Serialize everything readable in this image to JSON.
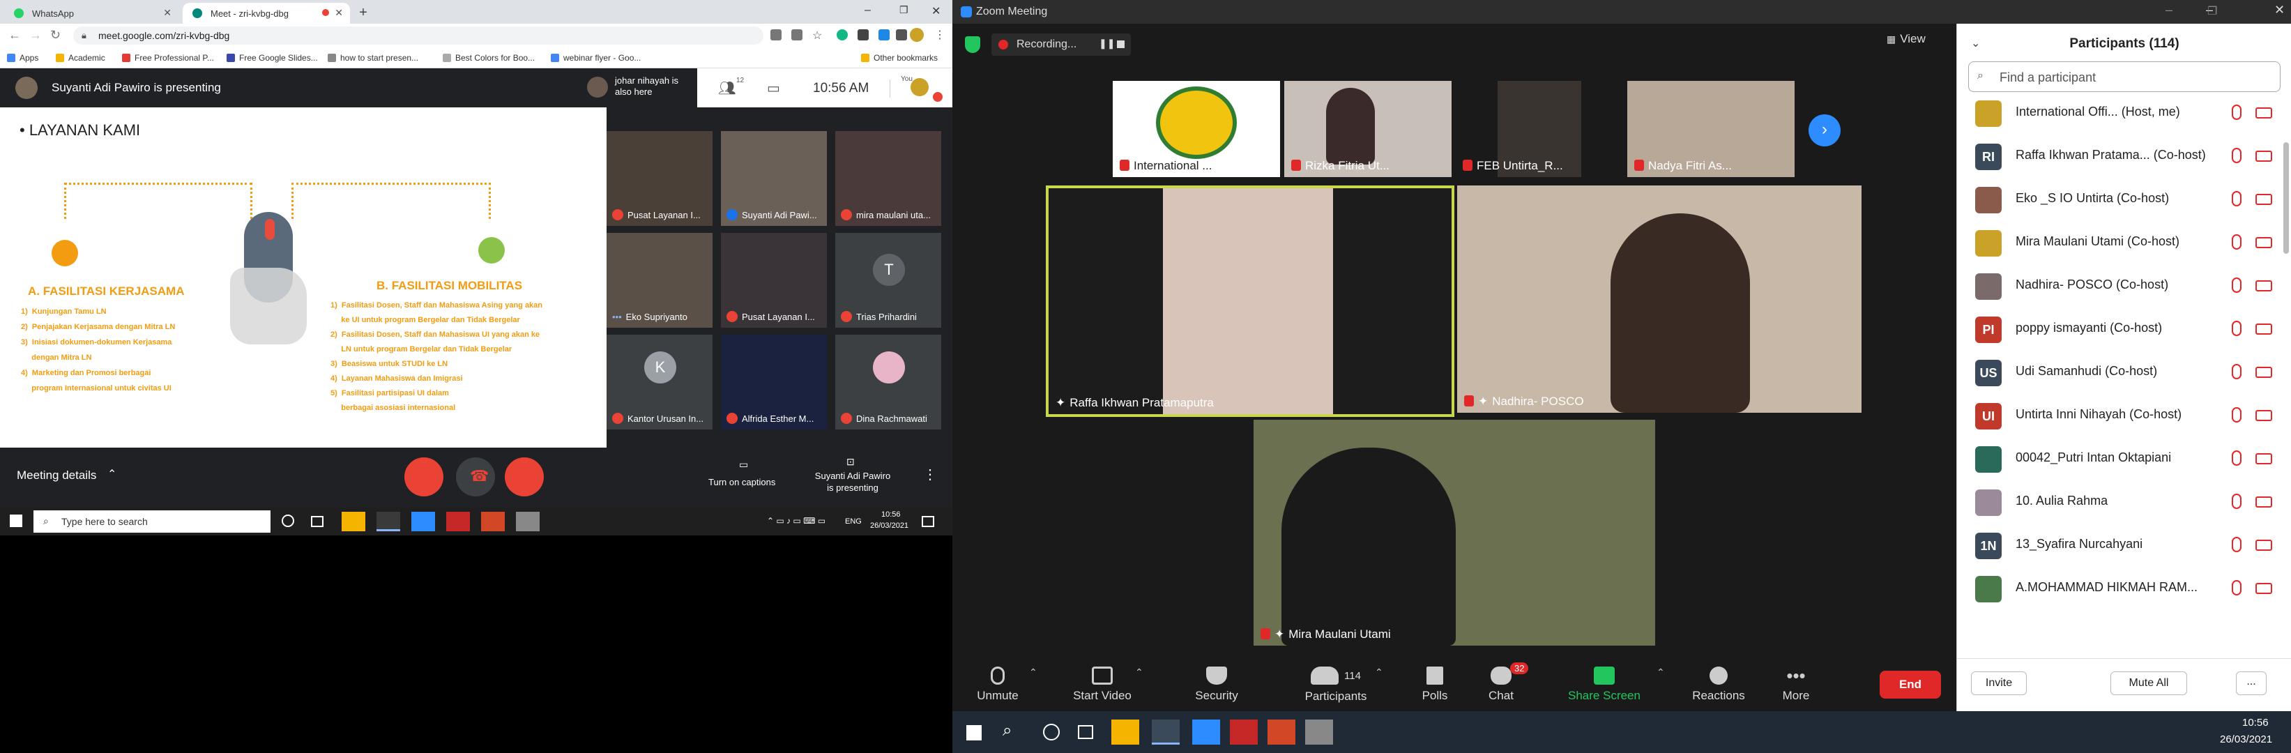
{
  "chrome": {
    "tabs": [
      {
        "label": "WhatsApp"
      },
      {
        "label": "Meet - zri-kvbg-dbg"
      }
    ],
    "url": "meet.google.com/zri-kvbg-dbg",
    "bookmarks": [
      "Apps",
      "Academic",
      "Free Professional P...",
      "Free Google Slides...",
      "how to start presen...",
      "Best Colors for Boo...",
      "webinar flyer - Goo...",
      "Other bookmarks"
    ]
  },
  "meet": {
    "presenter_banner": "Suyanti Adi Pawiro is presenting",
    "also_here": "johar nihayah is also here",
    "participant_count": "12",
    "time": "10:56 AM",
    "you_label": "You",
    "slide": {
      "title": "• LAYANAN KAMI",
      "section_a": "A. FASILITASI KERJASAMA",
      "items_a": [
        "1)  Kunjungan Tamu LN",
        "2)  Penjajakan Kerjasama dengan Mitra LN",
        "3)  Inisiasi dokumen-dokumen Kerjasama",
        "     dengan Mitra LN",
        "4)  Marketing dan Promosi berbagai",
        "     program Internasional untuk civitas UI"
      ],
      "section_b": "B. FASILITASI MOBILITAS",
      "items_b": [
        "1)  Fasilitasi Dosen, Staff dan Mahasiswa Asing yang akan",
        "     ke UI untuk program Bergelar dan Tidak Bergelar",
        "2)  Fasilitasi Dosen, Staff dan Mahasiswa UI yang akan ke",
        "     LN untuk program Bergelar dan Tidak Bergelar",
        "3)  Beasiswa untuk STUDI ke LN",
        "4)  Layanan Mahasiswa dan Imigrasi",
        "5)  Fasilitasi partisipasi UI dalam",
        "     berbagai asosiasi internasional"
      ]
    },
    "tiles": [
      {
        "name": "Pusat Layanan I..."
      },
      {
        "name": "Suyanti Adi Pawi..."
      },
      {
        "name": "mira maulani uta..."
      },
      {
        "name": "Eko Supriyanto"
      },
      {
        "name": "Pusat Layanan I..."
      },
      {
        "name": "Trias Prihardini",
        "initial": "T"
      },
      {
        "name": "Kantor Urusan In...",
        "initial": "K"
      },
      {
        "name": "Alfrida Esther M..."
      },
      {
        "name": "Dina Rachmawati"
      }
    ],
    "meeting_details": "Meeting details",
    "captions": "Turn on captions",
    "presenting": "Suyanti Adi Pawiro is presenting"
  },
  "taskbar_left": {
    "search_placeholder": "Type here to search",
    "lang": "ENG",
    "time": "10:56",
    "date": "26/03/2021"
  },
  "zoom": {
    "title": "Zoom Meeting",
    "recording": "Recording...",
    "view": "View",
    "top_tiles": [
      "International ...",
      "Rizka Fitria Ut...",
      "FEB Untirta_R...",
      "Nadya Fitri As..."
    ],
    "main_tiles": [
      "Raffa Ikhwan Pratamaputra",
      "Nadhira- POSCO",
      "Mira Maulani Utami"
    ],
    "toolbar": {
      "unmute": "Unmute",
      "start_video": "Start Video",
      "security": "Security",
      "participants": "Participants",
      "participants_count": "114",
      "polls": "Polls",
      "chat": "Chat",
      "chat_badge": "32",
      "share": "Share Screen",
      "reactions": "Reactions",
      "more": "More",
      "end": "End"
    },
    "panel": {
      "title": "Participants (114)",
      "search_placeholder": "Find a participant",
      "participants": [
        {
          "name": "International Offi... (Host, me)",
          "initials": "",
          "color": "#c9a227"
        },
        {
          "name": "Raffa Ikhwan Pratama... (Co-host)",
          "initials": "RI",
          "color": "#3b4a5a"
        },
        {
          "name": "Eko _S IO Untirta (Co-host)",
          "initials": "",
          "color": "#8a5a4a"
        },
        {
          "name": "Mira Maulani Utami (Co-host)",
          "initials": "",
          "color": "#c9a227"
        },
        {
          "name": "Nadhira- POSCO (Co-host)",
          "initials": "",
          "color": "#7a6a6a"
        },
        {
          "name": "poppy ismayanti (Co-host)",
          "initials": "PI",
          "color": "#c0392b"
        },
        {
          "name": "Udi Samanhudi (Co-host)",
          "initials": "US",
          "color": "#3b4a5a"
        },
        {
          "name": "Untirta Inni Nihayah (Co-host)",
          "initials": "UI",
          "color": "#c0392b"
        },
        {
          "name": "00042_Putri Intan Oktapiani",
          "initials": "",
          "color": "#2a6a5a"
        },
        {
          "name": "10. Aulia Rahma",
          "initials": "",
          "color": "#9a8a9a"
        },
        {
          "name": "13_Syafira Nurcahyani",
          "initials": "1N",
          "color": "#3b4a5a"
        },
        {
          "name": "A.MOHAMMAD HIKMAH RAM...",
          "initials": "",
          "color": "#4a7a4a"
        }
      ],
      "invite": "Invite",
      "mute_all": "Mute All",
      "more": "..."
    },
    "clock_time": "10:56",
    "clock_date": "26/03/2021"
  }
}
